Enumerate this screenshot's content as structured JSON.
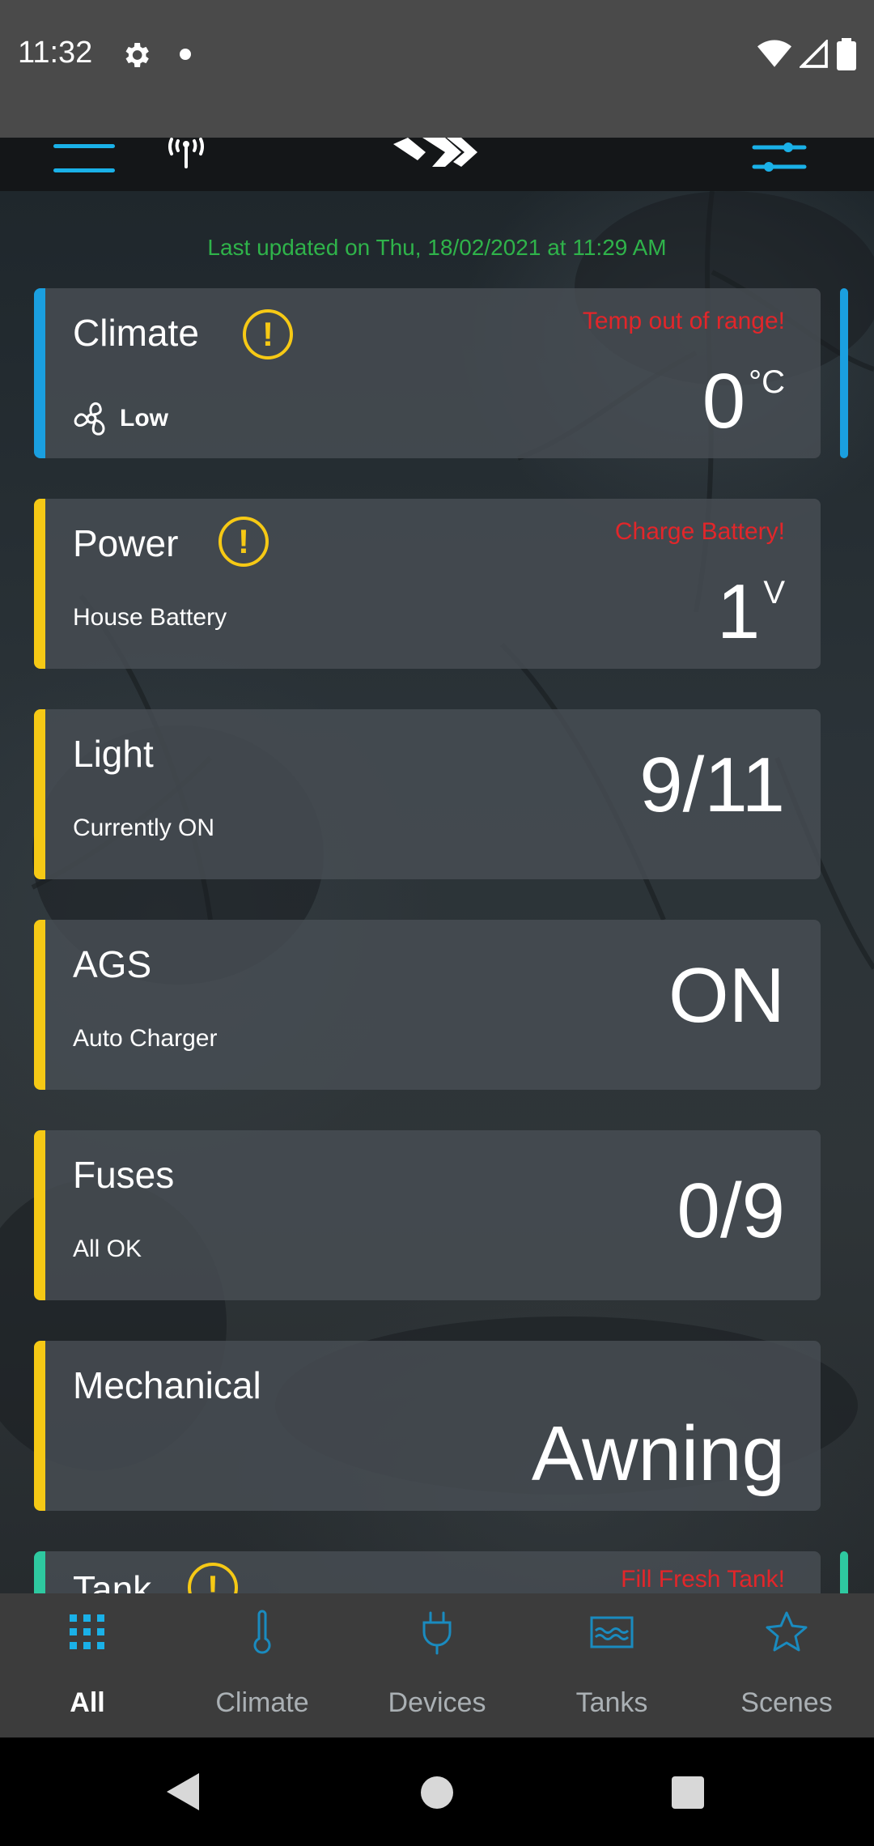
{
  "status_bar": {
    "time": "11:32"
  },
  "last_updated": "Last updated on Thu, 18/02/2021 at 11:29 AM",
  "cards": {
    "climate": {
      "title": "Climate",
      "alert": "Temp out of range!",
      "fan_label": "Low",
      "value": "0",
      "unit": "°C",
      "accent": "#1a9fe0"
    },
    "power": {
      "title": "Power",
      "alert": "Charge Battery!",
      "subtitle": "House Battery",
      "value": "1",
      "unit": "V",
      "accent": "#f6c915"
    },
    "light": {
      "title": "Light",
      "subtitle": "Currently ON",
      "value": "9/11",
      "accent": "#f6c915"
    },
    "ags": {
      "title": "AGS",
      "subtitle": "Auto Charger",
      "value": "ON",
      "accent": "#f6c915"
    },
    "fuses": {
      "title": "Fuses",
      "subtitle": "All OK",
      "value": "0/9",
      "accent": "#f6c915"
    },
    "mechanical": {
      "title": "Mechanical",
      "value": "Awning",
      "accent": "#f6c915"
    },
    "tank": {
      "title": "Tank",
      "alert": "Fill Fresh Tank!",
      "accent": "#2ec9a0"
    }
  },
  "bottom_nav": {
    "items": [
      {
        "label": "All",
        "icon": "grid-icon",
        "active": true
      },
      {
        "label": "Climate",
        "icon": "thermometer-icon"
      },
      {
        "label": "Devices",
        "icon": "plug-icon"
      },
      {
        "label": "Tanks",
        "icon": "tank-waves-icon"
      },
      {
        "label": "Scenes",
        "icon": "star-icon"
      }
    ]
  },
  "colors": {
    "accent_blue": "#1ab1e8",
    "warning_yellow": "#f6c915",
    "alert_red": "#e2262a",
    "updated_green": "#2fb34a"
  }
}
